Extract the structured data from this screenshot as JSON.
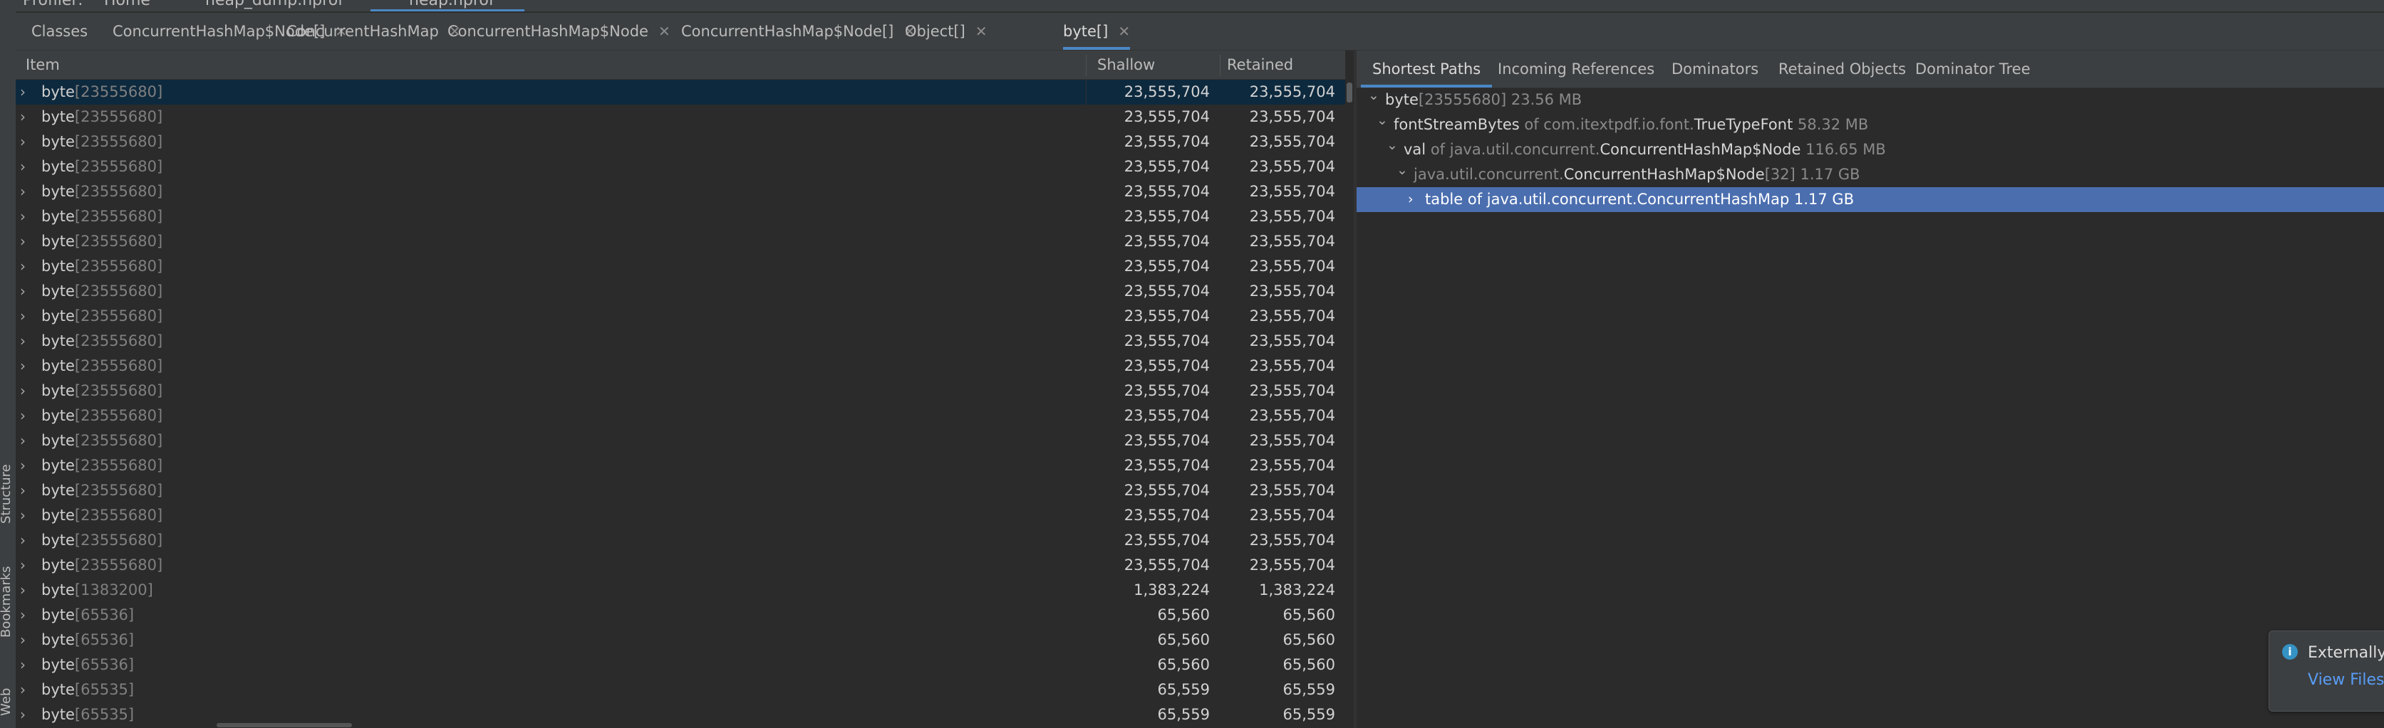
{
  "window_tabs": [
    "Profiler:",
    "Home",
    "heap_dump.hprof",
    "heap.hprof"
  ],
  "sidebar": {
    "structure": "Structure",
    "bookmarks": "Bookmarks",
    "web": "Web"
  },
  "tabs": [
    {
      "label": "Classes",
      "closable": false
    },
    {
      "label": "ConcurrentHashMap$Node[]",
      "closable": true
    },
    {
      "label": "ConcurrentHashMap",
      "closable": true
    },
    {
      "label": "ConcurrentHashMap$Node",
      "closable": true
    },
    {
      "label": "ConcurrentHashMap$Node[]",
      "closable": true
    },
    {
      "label": "Object[]",
      "closable": true
    },
    {
      "label": "byte[]",
      "closable": true,
      "active": true
    }
  ],
  "table": {
    "headers": {
      "item": "Item",
      "shallow": "Shallow",
      "retained": "Retained"
    },
    "rows": [
      {
        "name": "byte",
        "dims": "[23555680]",
        "shallow": "23,555,704",
        "retained": "23,555,704",
        "selected": true
      },
      {
        "name": "byte",
        "dims": "[23555680]",
        "shallow": "23,555,704",
        "retained": "23,555,704"
      },
      {
        "name": "byte",
        "dims": "[23555680]",
        "shallow": "23,555,704",
        "retained": "23,555,704"
      },
      {
        "name": "byte",
        "dims": "[23555680]",
        "shallow": "23,555,704",
        "retained": "23,555,704"
      },
      {
        "name": "byte",
        "dims": "[23555680]",
        "shallow": "23,555,704",
        "retained": "23,555,704"
      },
      {
        "name": "byte",
        "dims": "[23555680]",
        "shallow": "23,555,704",
        "retained": "23,555,704"
      },
      {
        "name": "byte",
        "dims": "[23555680]",
        "shallow": "23,555,704",
        "retained": "23,555,704"
      },
      {
        "name": "byte",
        "dims": "[23555680]",
        "shallow": "23,555,704",
        "retained": "23,555,704"
      },
      {
        "name": "byte",
        "dims": "[23555680]",
        "shallow": "23,555,704",
        "retained": "23,555,704"
      },
      {
        "name": "byte",
        "dims": "[23555680]",
        "shallow": "23,555,704",
        "retained": "23,555,704"
      },
      {
        "name": "byte",
        "dims": "[23555680]",
        "shallow": "23,555,704",
        "retained": "23,555,704"
      },
      {
        "name": "byte",
        "dims": "[23555680]",
        "shallow": "23,555,704",
        "retained": "23,555,704"
      },
      {
        "name": "byte",
        "dims": "[23555680]",
        "shallow": "23,555,704",
        "retained": "23,555,704"
      },
      {
        "name": "byte",
        "dims": "[23555680]",
        "shallow": "23,555,704",
        "retained": "23,555,704"
      },
      {
        "name": "byte",
        "dims": "[23555680]",
        "shallow": "23,555,704",
        "retained": "23,555,704"
      },
      {
        "name": "byte",
        "dims": "[23555680]",
        "shallow": "23,555,704",
        "retained": "23,555,704"
      },
      {
        "name": "byte",
        "dims": "[23555680]",
        "shallow": "23,555,704",
        "retained": "23,555,704"
      },
      {
        "name": "byte",
        "dims": "[23555680]",
        "shallow": "23,555,704",
        "retained": "23,555,704"
      },
      {
        "name": "byte",
        "dims": "[23555680]",
        "shallow": "23,555,704",
        "retained": "23,555,704"
      },
      {
        "name": "byte",
        "dims": "[23555680]",
        "shallow": "23,555,704",
        "retained": "23,555,704"
      },
      {
        "name": "byte",
        "dims": "[1383200]",
        "shallow": "1,383,224",
        "retained": "1,383,224"
      },
      {
        "name": "byte",
        "dims": "[65536]",
        "shallow": "65,560",
        "retained": "65,560"
      },
      {
        "name": "byte",
        "dims": "[65536]",
        "shallow": "65,560",
        "retained": "65,560"
      },
      {
        "name": "byte",
        "dims": "[65536]",
        "shallow": "65,560",
        "retained": "65,560"
      },
      {
        "name": "byte",
        "dims": "[65535]",
        "shallow": "65,559",
        "retained": "65,559"
      },
      {
        "name": "byte",
        "dims": "[65535]",
        "shallow": "65,559",
        "retained": "65,559"
      }
    ]
  },
  "right_tabs": [
    "Shortest Paths",
    "Incoming References",
    "Dominators",
    "Retained Objects",
    "Dominator Tree"
  ],
  "tree": [
    {
      "parts": [
        [
          "w",
          "byte"
        ],
        [
          "g",
          "[23555680] 23.56 MB"
        ]
      ]
    },
    {
      "parts": [
        [
          "w",
          "fontStreamBytes "
        ],
        [
          "g",
          "of com.itextpdf.io.font."
        ],
        [
          "w",
          "TrueTypeFont"
        ],
        [
          "g",
          " 58.32 MB"
        ]
      ]
    },
    {
      "parts": [
        [
          "w",
          "val "
        ],
        [
          "g",
          "of java.util.concurrent."
        ],
        [
          "w",
          "ConcurrentHashMap$Node"
        ],
        [
          "g",
          " 116.65 MB"
        ]
      ]
    },
    {
      "parts": [
        [
          "g",
          "java.util.concurrent."
        ],
        [
          "w",
          "ConcurrentHashMap$Node"
        ],
        [
          "g",
          "[32] 1.17 GB"
        ]
      ]
    },
    {
      "parts": [
        [
          "w",
          "table "
        ],
        [
          "g",
          "of java.util.concurrent."
        ],
        [
          "w",
          "ConcurrentHashMap"
        ],
        [
          "g",
          " 1.17 GB"
        ]
      ],
      "selected": true
    }
  ],
  "notification": {
    "title": "Externally",
    "link": "View Files"
  },
  "icons": {
    "expand": "chevron-right-icon",
    "collapse": "chevron-down-icon",
    "close": "close-icon",
    "info": "info-icon"
  },
  "colors": {
    "accent": "#4a88c7",
    "selection_tree": "#4b6eaf",
    "selection_table": "#0d293e",
    "background": "#2b2b2b",
    "panel": "#3c3f41"
  }
}
